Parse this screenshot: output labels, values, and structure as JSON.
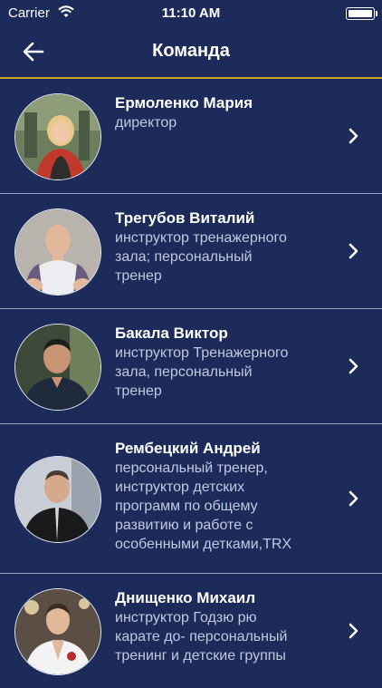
{
  "status_bar": {
    "carrier": "Carrier",
    "time": "11:10 AM"
  },
  "nav": {
    "title": "Команда",
    "back_icon": "arrow-left-icon"
  },
  "colors": {
    "background": "#1c2b5a",
    "accent_line": "#c9a227",
    "divider": "#9aa6c4",
    "role_text": "#c0c9e0"
  },
  "team": [
    {
      "name": "Ермоленко Мария",
      "role": "директор"
    },
    {
      "name": "Трегубов Виталий",
      "role": "инструктор тренажерного\nзала; персональный\nтренер"
    },
    {
      "name": "Бакала Виктор",
      "role": "инструктор Тренажерного\nзала, персональный\nтренер"
    },
    {
      "name": "Рембецкий Андрей",
      "role": "персональный тренер,\nинструктор детских\nпрограмм по общему\nразвитию и работе с\nособенными детками,TRX"
    },
    {
      "name": "Днищенко Михаил",
      "role": "инструктор Годзю рю\nкарате до- персональный\nтренинг и детские группы"
    }
  ]
}
